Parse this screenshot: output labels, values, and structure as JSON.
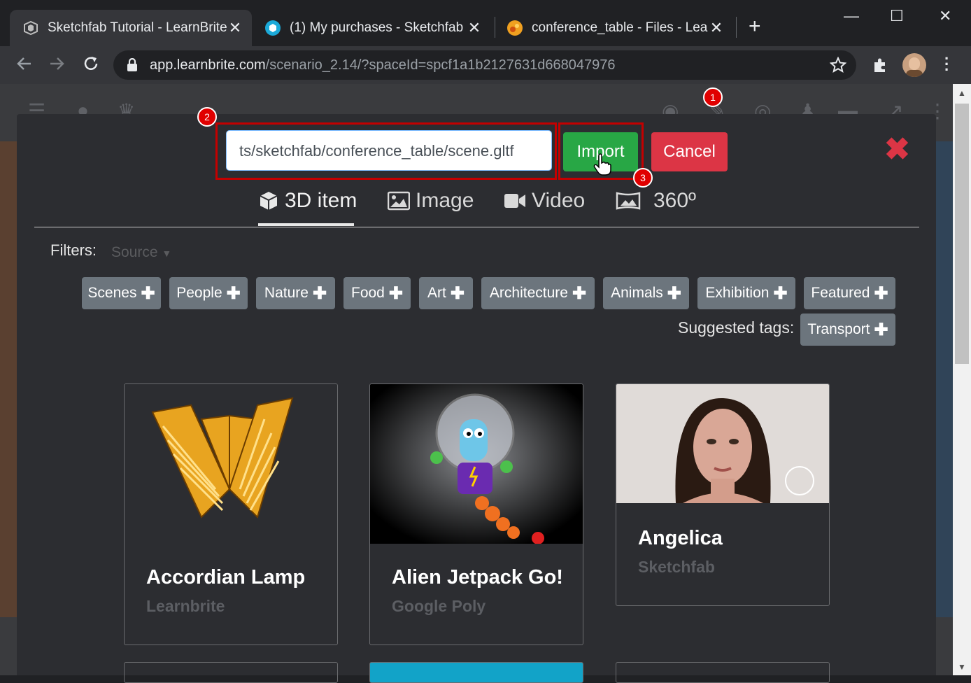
{
  "browser": {
    "tabs": [
      {
        "title": "Sketchfab Tutorial - LearnBrite S",
        "close": "✕"
      },
      {
        "title": "(1) My purchases - Sketchfab",
        "close": "✕"
      },
      {
        "title": "conference_table - Files - Learnl",
        "close": "✕"
      }
    ],
    "new_tab": "+",
    "window_controls": {
      "minimize": "—",
      "maximize": "☐",
      "close": "✕"
    },
    "url_host": "app.learnbrite.com",
    "url_path": "/scenario_2.14/?spaceId=spcf1a1b2127631d668047976",
    "icons": [
      "back-icon",
      "forward-icon",
      "reload-icon",
      "lock-icon",
      "star-icon",
      "extensions-icon",
      "profile-avatar",
      "menu-dots-icon"
    ]
  },
  "modal": {
    "url_value": "ts/sketchfab/conference_table/scene.gltf",
    "import_label": "Import",
    "cancel_label": "Cancel",
    "close_icon": "✖",
    "annotations": [
      "1",
      "2",
      "3"
    ],
    "media_tabs": [
      {
        "label": "3D item",
        "icon": "cube-icon",
        "active": true
      },
      {
        "label": "Image",
        "icon": "image-icon"
      },
      {
        "label": "Video",
        "icon": "video-icon"
      },
      {
        "label": "360º",
        "icon": "panorama-icon"
      }
    ],
    "filters_label": "Filters:",
    "source_placeholder": "Source",
    "tags": [
      "Scenes",
      "People",
      "Nature",
      "Food",
      "Art",
      "Architecture",
      "Animals",
      "Exhibition",
      "Featured"
    ],
    "tag_plus": "✚",
    "suggested_label": "Suggested tags:",
    "suggested_tags": [
      "Transport"
    ],
    "cards": [
      {
        "title": "Accordian Lamp",
        "source": "Learnbrite"
      },
      {
        "title": "Alien Jetpack Go!",
        "source": "Google Poly"
      },
      {
        "title": "Angelica",
        "source": "Sketchfab"
      }
    ]
  },
  "colors": {
    "import": "#28a745",
    "cancel": "#dc3545",
    "close_x": "#dc3545",
    "tag": "#6c757d",
    "annotation": "#c40000"
  }
}
